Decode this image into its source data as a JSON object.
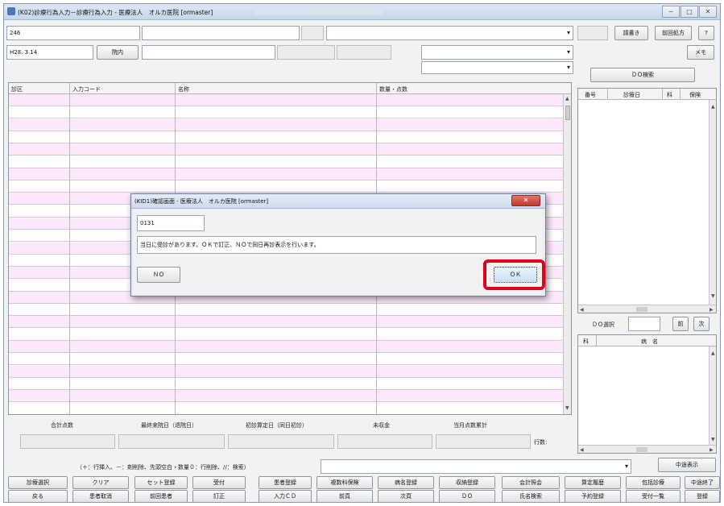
{
  "window": {
    "title": "(K02)診療行為入力－診療行為入力 - 医療法人　オルカ医院 [ormaster]",
    "controls": [
      "─",
      "□",
      "✕"
    ]
  },
  "top": {
    "patient_id": "246",
    "date": "H28. 3.14",
    "inout_button": "院内",
    "chart_button": "請書き",
    "prev_rx_button": "前回処方",
    "help_button": "?",
    "memo_button": "メモ",
    "do_search_button": "ＤＯ検索"
  },
  "grid": {
    "columns": [
      "診区",
      "入力コード",
      "名称",
      "数量・点数"
    ],
    "row_count": 26
  },
  "history_panel": {
    "columns": [
      "番号",
      "診療日",
      "科",
      "保険"
    ]
  },
  "do_select": {
    "label": "ＤＯ選択",
    "prev": "前",
    "next": "次"
  },
  "disease_panel": {
    "columns": [
      "科",
      "病　名"
    ]
  },
  "summary": {
    "labels": [
      "合計点数",
      "最終来院日（退院日）",
      "初診算定日（同日初診）",
      "未収金",
      "当月点数累計"
    ],
    "rows_label": "行数:"
  },
  "hint": "（＋：行挿入、－：剤削除、先頭空白・数量０：行削除、//：検索）",
  "interrupt_display": "中途表示",
  "fkeys_row1": [
    "診療選択",
    "クリア",
    "セット登録",
    "受付",
    "患者登録",
    "複数科保険",
    "病名登録",
    "収納登録",
    "会計照会",
    "算定履歴",
    "包括診療",
    "中途終了"
  ],
  "fkeys_row2": [
    "戻る",
    "患者取消",
    "前回患者",
    "訂正",
    "入力ＣＤ",
    "前頁",
    "次頁",
    "ＤＯ",
    "氏名検索",
    "予約登録",
    "受付一覧",
    "登録"
  ],
  "dialog": {
    "title": "(KID1)確認画面 - 医療法人　オルカ医院 [ormaster]",
    "code": "0131",
    "message": "当日に受診があります。ＯＫで訂正、ＮＯで同日再診表示を行います。",
    "no_label": "ＮＯ",
    "ok_label": "ＯＫ",
    "close": "✕"
  },
  "highlight_color": "#e0001b"
}
